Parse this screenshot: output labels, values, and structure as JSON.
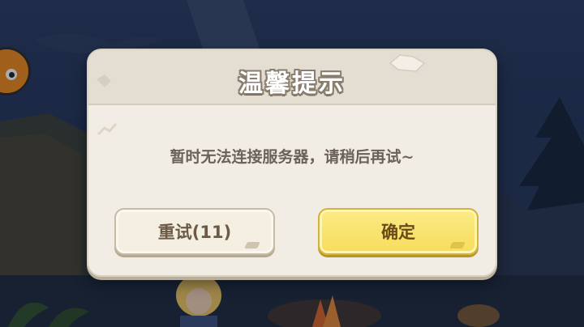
{
  "dialog": {
    "title": "温馨提示",
    "message": "暂时无法连接服务器，请稍后再试~",
    "retry_button": "重试(11)",
    "confirm_button": "确定"
  },
  "colors": {
    "dialog_bg": "#f1ede5",
    "header_bg": "#e4ded2",
    "confirm_button": "#f6dd5b",
    "retry_button": "#f5efe2",
    "message_text": "#6a6258"
  },
  "icons": {
    "corner_avatar": "orange-creature-icon"
  }
}
